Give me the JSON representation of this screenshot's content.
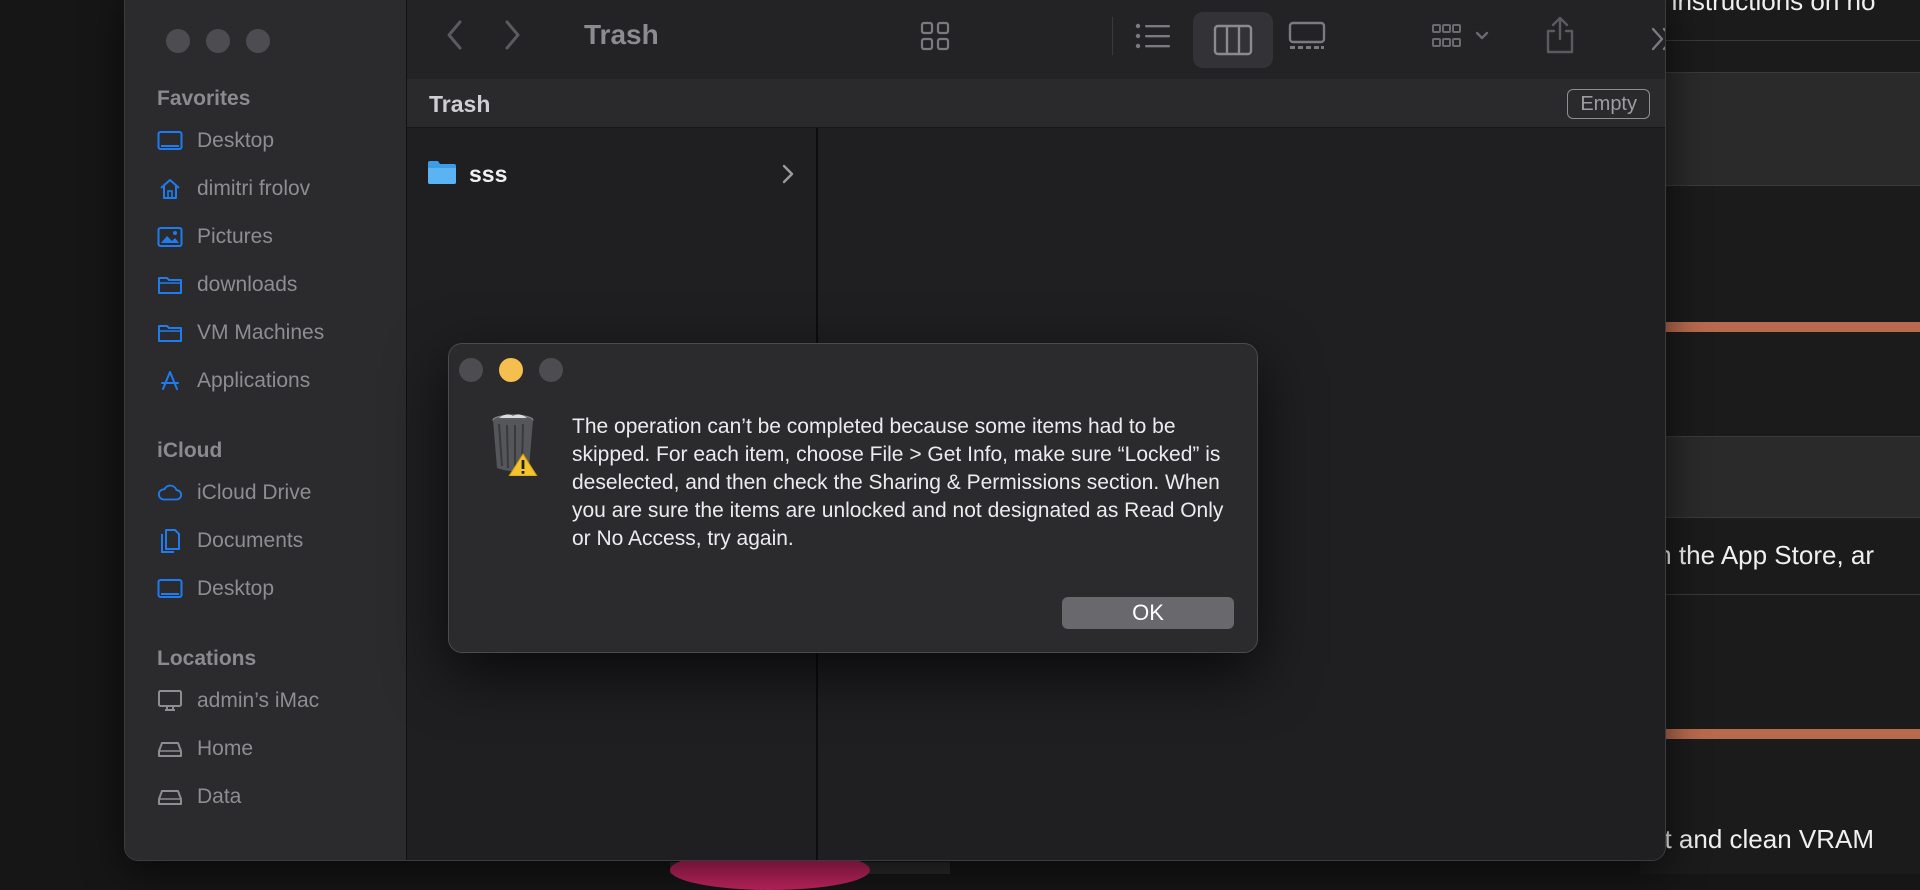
{
  "background_page": {
    "texts": [
      "n instructions on ho",
      "m the App Store, ar",
      "ot and clean VRAM"
    ],
    "accent_color": "#b86a4e"
  },
  "window": {
    "title": "Trash",
    "path_title": "Trash",
    "empty_label": "Empty"
  },
  "sidebar": {
    "favorites_title": "Favorites",
    "favorites": [
      {
        "label": "Desktop",
        "icon": "desktop-icon"
      },
      {
        "label": "dimitri frolov",
        "icon": "home-icon"
      },
      {
        "label": "Pictures",
        "icon": "pictures-icon"
      },
      {
        "label": "downloads",
        "icon": "folder-icon"
      },
      {
        "label": "VM Machines",
        "icon": "folder-icon"
      },
      {
        "label": "Applications",
        "icon": "applications-icon"
      }
    ],
    "icloud_title": "iCloud",
    "icloud": [
      {
        "label": "iCloud Drive",
        "icon": "cloud-icon"
      },
      {
        "label": "Documents",
        "icon": "documents-icon"
      },
      {
        "label": "Desktop",
        "icon": "desktop-icon"
      }
    ],
    "locations_title": "Locations",
    "locations": [
      {
        "label": "admin’s iMac",
        "icon": "computer-icon"
      },
      {
        "label": "Home",
        "icon": "drive-icon"
      },
      {
        "label": "Data",
        "icon": "drive-icon"
      }
    ]
  },
  "files": [
    {
      "name": "sss",
      "icon": "folder-icon"
    }
  ],
  "dialog": {
    "message": "The operation can’t be completed because some items had to be skipped. For each item, choose File > Get Info, make sure “Locked” is deselected, and then check the Sharing & Permissions section. When you are sure the items are unlocked and not designated as Read Only or No Access, try again.",
    "ok_label": "OK"
  },
  "colors": {
    "sidebar_icon": "#1e7cf0",
    "traffic_yellow": "#f4bf4f"
  }
}
